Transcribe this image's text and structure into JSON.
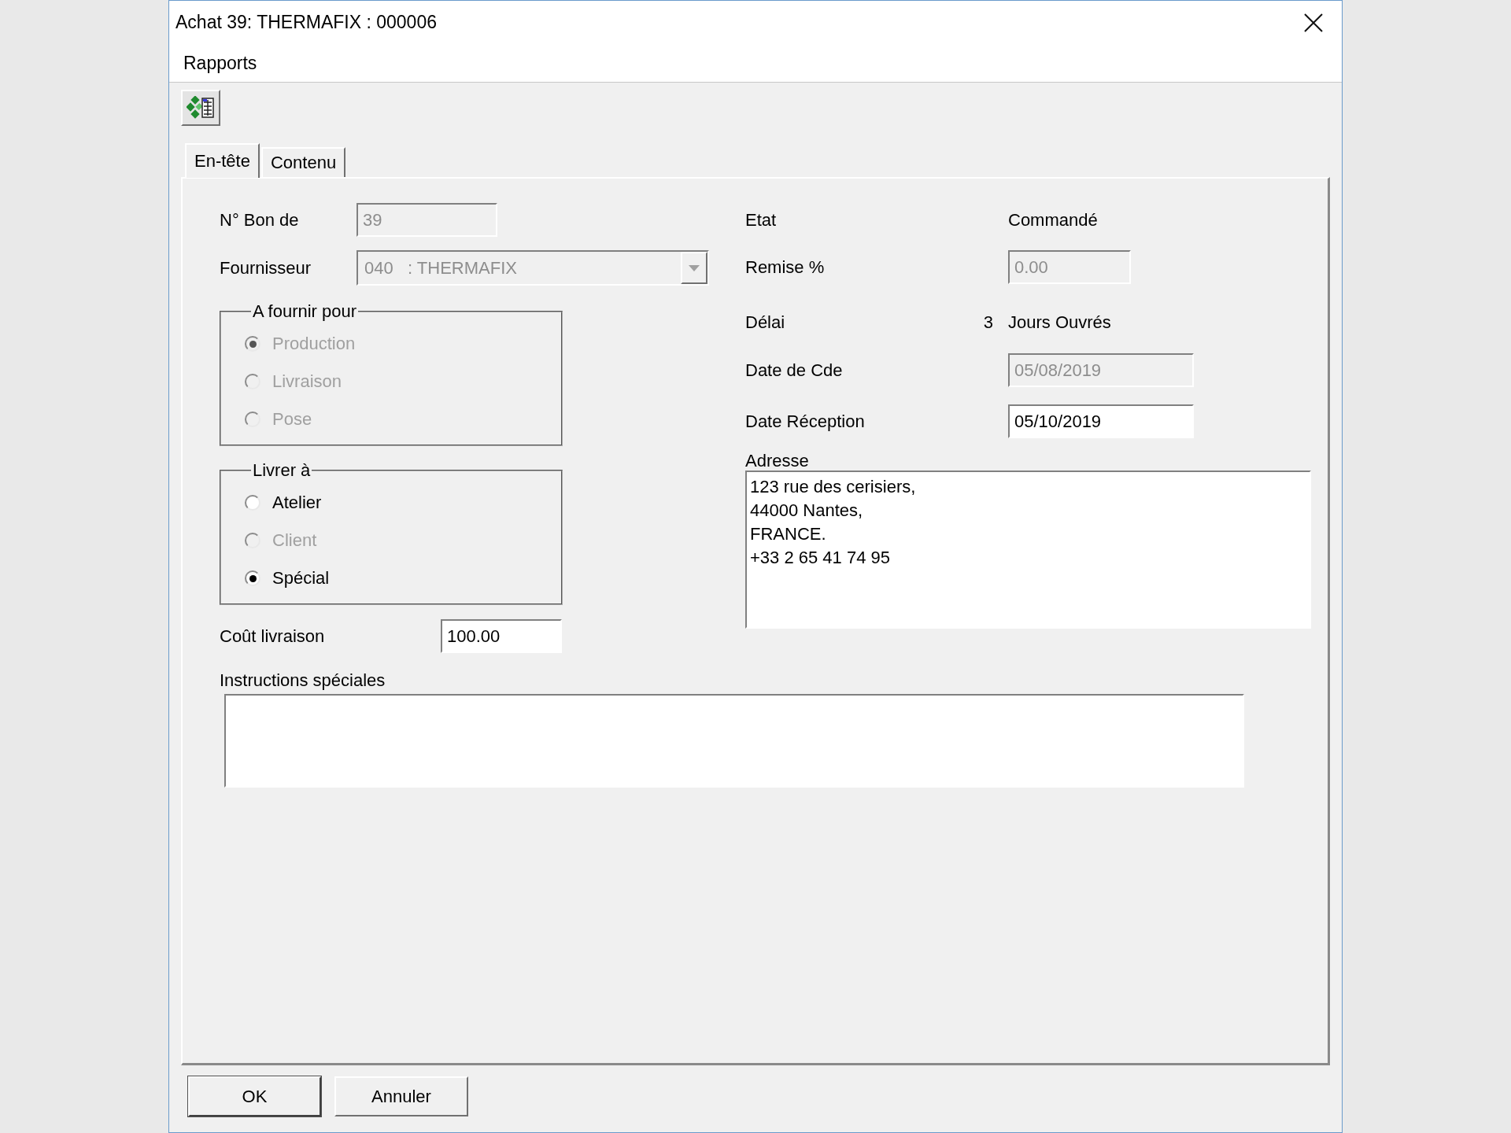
{
  "window": {
    "title": "Achat 39: THERMAFIX : 000006"
  },
  "menu": [
    "Rapports"
  ],
  "tabs": [
    {
      "label": "En-tête",
      "selected": true
    },
    {
      "label": "Contenu",
      "selected": false
    }
  ],
  "left_fields": [
    {
      "label": "N° Bon de",
      "value": "39",
      "disabled": true,
      "kind": "text"
    },
    {
      "label": "Fournisseur",
      "value": "040   : THERMAFIX",
      "disabled": true,
      "kind": "combo"
    }
  ],
  "groups": [
    {
      "title": "A fournir pour",
      "options": [
        {
          "label": "Production",
          "selected": true,
          "disabled": true
        },
        {
          "label": "Livraison",
          "selected": false,
          "disabled": true
        },
        {
          "label": "Pose",
          "selected": false,
          "disabled": true
        }
      ]
    },
    {
      "title": "Livrer à",
      "options": [
        {
          "label": "Atelier",
          "selected": false,
          "disabled": false
        },
        {
          "label": "Client",
          "selected": false,
          "disabled": true
        },
        {
          "label": "Spécial",
          "selected": true,
          "disabled": false
        }
      ]
    }
  ],
  "delivery_cost": {
    "label": "Coût livraison",
    "value": "100.00",
    "disabled": false
  },
  "right_fields": [
    {
      "kind": "static",
      "label": "Etat",
      "value": "Commandé"
    },
    {
      "kind": "short_text",
      "label": "Remise %",
      "value": "0.00",
      "disabled": true
    },
    {
      "kind": "quantity",
      "label": "Délai",
      "number": "3",
      "value": "Jours Ouvrés"
    },
    {
      "kind": "text",
      "label": "Date de Cde",
      "value": "05/08/2019",
      "disabled": true
    },
    {
      "kind": "text",
      "label": "Date Réception",
      "value": "05/10/2019",
      "disabled": false
    }
  ],
  "address": {
    "label": "Adresse",
    "value": "123 rue des cerisiers,\n44000 Nantes,\nFRANCE.\n+33 2 65 41 74 95"
  },
  "instructions": {
    "label": "Instructions spéciales"
  },
  "buttons": [
    {
      "label": "OK",
      "default": true
    },
    {
      "label": "Annuler",
      "default": false
    }
  ]
}
